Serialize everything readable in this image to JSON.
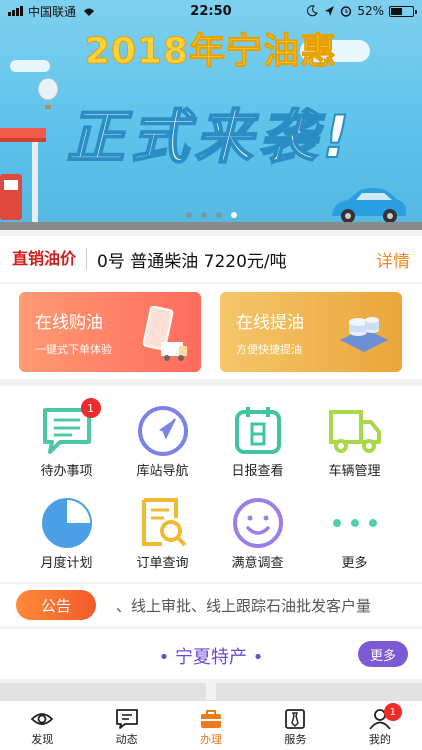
{
  "status_bar": {
    "carrier": "中国联通",
    "time": "22:50",
    "battery": "52%",
    "battery_level": 0.52
  },
  "banner": {
    "title_year": "2018",
    "title_rest": "年宁油惠",
    "subtitle": "正式来袭!",
    "slides": 4,
    "active_slide": 4
  },
  "price": {
    "tag": "直销油价",
    "text": "0号  普通柴油  7220元/吨",
    "detail": "详情"
  },
  "quick": [
    {
      "title": "在线购油",
      "subtitle": "一键式下单体验"
    },
    {
      "title": "在线提油",
      "subtitle": "方便快捷提油"
    }
  ],
  "grid": {
    "items": [
      {
        "label": "待办事项",
        "icon": "message-icon",
        "color": "#4cc8a6",
        "badge": "1"
      },
      {
        "label": "库站导航",
        "icon": "navigation-icon",
        "color": "#7b83e6"
      },
      {
        "label": "日报查看",
        "icon": "calendar-icon",
        "color": "#43c3a0"
      },
      {
        "label": "车辆管理",
        "icon": "truck-icon",
        "color": "#a9d84a"
      },
      {
        "label": "月度计划",
        "icon": "pie-chart-icon",
        "color": "#4b9fe5"
      },
      {
        "label": "订单查询",
        "icon": "order-search-icon",
        "color": "#f0b934"
      },
      {
        "label": "满意调查",
        "icon": "smile-icon",
        "color": "#9b7fe6"
      },
      {
        "label": "更多",
        "icon": "more-icon",
        "color": "#4dd0b0"
      }
    ]
  },
  "notice": {
    "tag": "公告",
    "text": "、线上审批、线上跟踪石油批发客户量"
  },
  "special": {
    "title": "• 宁夏特产 •",
    "more": "更多"
  },
  "tabbar": {
    "items": [
      {
        "label": "发现",
        "icon": "eye-icon"
      },
      {
        "label": "动态",
        "icon": "news-icon"
      },
      {
        "label": "办理",
        "icon": "briefcase-icon",
        "active": true
      },
      {
        "label": "服务",
        "icon": "tie-icon"
      },
      {
        "label": "我的",
        "icon": "user-icon",
        "badge": "1"
      }
    ]
  },
  "colors": {
    "accent_orange": "#ee7a1e",
    "price_red": "#d21e1e",
    "purple": "#7c5ad4"
  }
}
